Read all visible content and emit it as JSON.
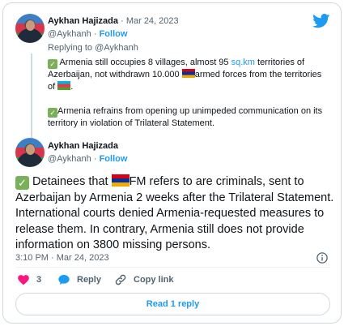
{
  "colors": {
    "accent": "#1d9bf0",
    "like": "#f91880",
    "text": "#0f1419",
    "muted": "#536471"
  },
  "icons": {
    "brand": "twitter-bird-icon",
    "like": "heart-icon",
    "reply": "speech-bubble-icon",
    "copy": "link-icon",
    "info": "info-icon"
  },
  "parent_tweet": {
    "author": "Aykhan Hajizada",
    "sep": "·",
    "date": "Mar 24, 2023",
    "handle": "@Aykhanh",
    "follow": "Follow",
    "replying_prefix": "Replying to",
    "replying_handle": "@Aykhanh",
    "p1_a": " Armenia still occupies 8 villages, almost 95 ",
    "p1_link": "sq.km",
    "p1_b": " territories of Azerbaijan, not withdrawn 10.000 ",
    "p1_c": "armed forces from the territories of ",
    "p1_d": ".",
    "p2": "Armenia refrains from opening up unimpeded communication on its territory in violation of Trilateral Statement."
  },
  "main_tweet": {
    "author": "Aykhan Hajizada",
    "handle": "@Aykhanh",
    "sep": "·",
    "follow": "Follow",
    "text_a": " Detainees that ",
    "text_b": "FM refers to are criminals, sent to Azerbaijan by Armenia 2 weeks after the Trilateral Statement. International courts denied Armenia-requested measures to release them. In contrary, Armenia still does not provide information on 3800 missing persons.",
    "timestamp": "3:10 PM · Mar 24, 2023"
  },
  "actions": {
    "likes": "3",
    "reply": "Reply",
    "copy": "Copy link"
  },
  "read_more": "Read 1 reply"
}
